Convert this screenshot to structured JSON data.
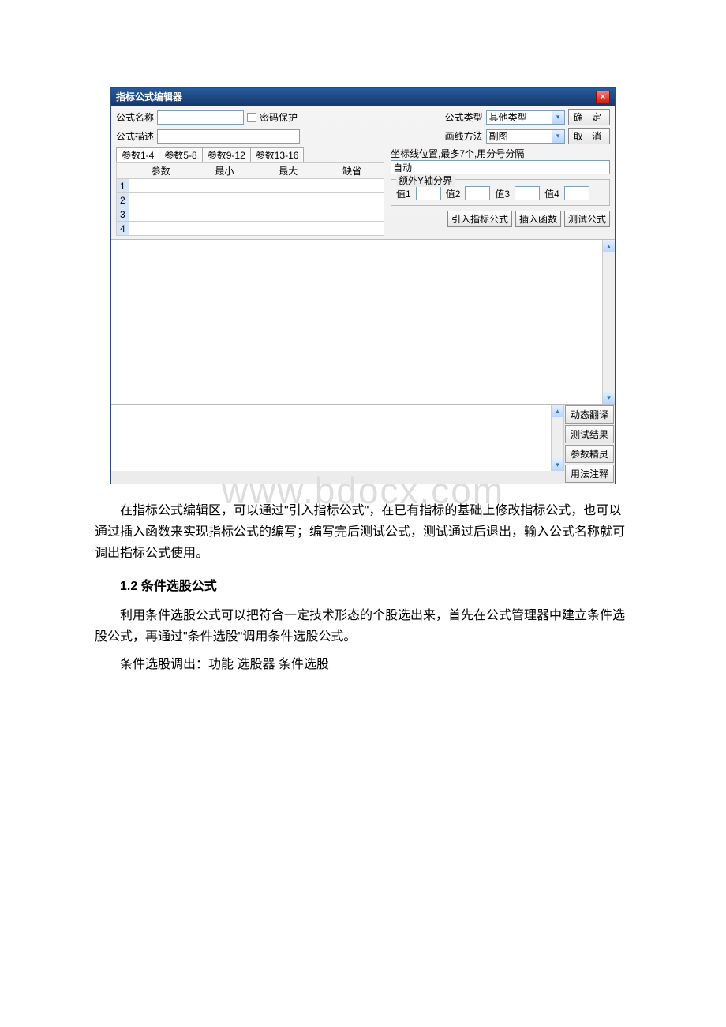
{
  "window": {
    "title": "指标公式编辑器",
    "close_label": "×"
  },
  "labels": {
    "formula_name": "公式名称",
    "password_protect": "密码保护",
    "formula_type": "公式类型",
    "formula_type_value": "其他类型",
    "formula_desc": "公式描述",
    "draw_method": "画线方法",
    "draw_method_value": "副图",
    "ok": "确 定",
    "cancel": "取 消"
  },
  "tabs": [
    "参数1-4",
    "参数5-8",
    "参数9-12",
    "参数13-16"
  ],
  "param_headers": [
    "参数",
    "最小",
    "最大",
    "缺省"
  ],
  "param_rows": [
    "1",
    "2",
    "3",
    "4"
  ],
  "coord": {
    "label": "坐标线位置,最多7个,用分号分隔",
    "value": "自动"
  },
  "y_axis": {
    "legend": "额外Y轴分界",
    "vals": [
      "值1",
      "值2",
      "值3",
      "值4"
    ]
  },
  "actions": {
    "import_formula": "引入指标公式",
    "insert_func": "插入函数",
    "test_formula": "测试公式"
  },
  "side_buttons": [
    "动态翻译",
    "测试结果",
    "参数精灵",
    "用法注释"
  ],
  "watermark": "www.bdocx.com",
  "article": {
    "p1": "在指标公式编辑区，可以通过\"引入指标公式\"，在已有指标的基础上修改指标公式，也可以通过插入函数来实现指标公式的编写；编写完后测试公式，测试通过后退出，输入公式名称就可调出指标公式使用。",
    "h1": "1.2 条件选股公式",
    "p2": "利用条件选股公式可以把符合一定技术形态的个股选出来，首先在公式管理器中建立条件选股公式，再通过\"条件选股\"调用条件选股公式。",
    "p3": "条件选股调出：功能 选股器 条件选股"
  }
}
